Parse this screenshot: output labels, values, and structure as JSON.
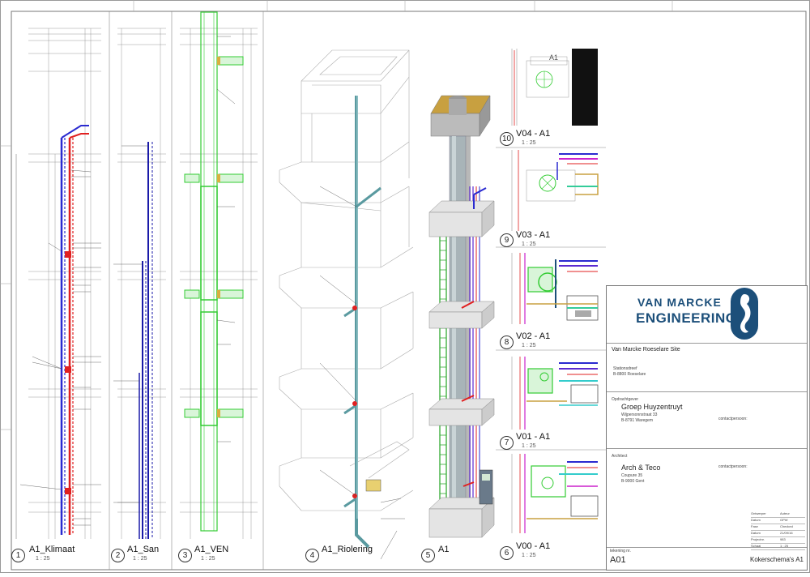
{
  "views": [
    {
      "num": "1",
      "title": "A1_Klimaat",
      "scale": "1 : 25"
    },
    {
      "num": "2",
      "title": "A1_San",
      "scale": "1 : 25"
    },
    {
      "num": "3",
      "title": "A1_VEN",
      "scale": "1 : 25"
    },
    {
      "num": "4",
      "title": "A1_Riolering",
      "scale": ""
    },
    {
      "num": "5",
      "title": "A1",
      "scale": ""
    },
    {
      "num": "10",
      "title": "V04 - A1",
      "scale": "1 : 25"
    },
    {
      "num": "9",
      "title": "V03 - A1",
      "scale": "1 : 25"
    },
    {
      "num": "8",
      "title": "V02 - A1",
      "scale": "1 : 25"
    },
    {
      "num": "7",
      "title": "V01 - A1",
      "scale": "1 : 25"
    },
    {
      "num": "6",
      "title": "V00 - A1",
      "scale": "1 : 25"
    }
  ],
  "detail_tag": "A1",
  "company": {
    "name_top": "VAN MARCKE",
    "name_bottom": "ENGINEERING"
  },
  "project": {
    "title": "Van Marcke Roeselare Site",
    "street": "Stationsdreef",
    "city": "B-8800 Roeselare"
  },
  "client": {
    "heading": "Opdrachtgever",
    "name": "Groep Huyzentruyt",
    "street": "Wijpersonnstraat 33",
    "city": "B-8791 Waregem",
    "contact": "contactpersoon:"
  },
  "architect": {
    "heading": "Architect",
    "name": "Arch & Teco",
    "street": "Coupure 35",
    "city": "B-9000 Gent",
    "contact": "contactpersoon:"
  },
  "sheet": {
    "number_label": "tekening nr.",
    "number": "A01",
    "name": "Kokerschema's A1"
  },
  "titleblock_rows": [
    {
      "k": "Ontwerper",
      "v": "Auteur"
    },
    {
      "k": "Datum",
      "v": "GPW"
    },
    {
      "k": "Fase",
      "v": "Checked"
    },
    {
      "k": "Datum",
      "v": "21/09/16"
    },
    {
      "k": "Projectnr.",
      "v": "983"
    },
    {
      "k": "Schaal",
      "v": "1 : 25"
    }
  ],
  "colors": {
    "klimaat_red": "#e02020",
    "klimaat_blue": "#2a2ad0",
    "san_blue": "#1a1aa8",
    "ven_green": "#33cc33",
    "riool_teal": "#5a9aa0",
    "brand": "#1c4f7a"
  }
}
